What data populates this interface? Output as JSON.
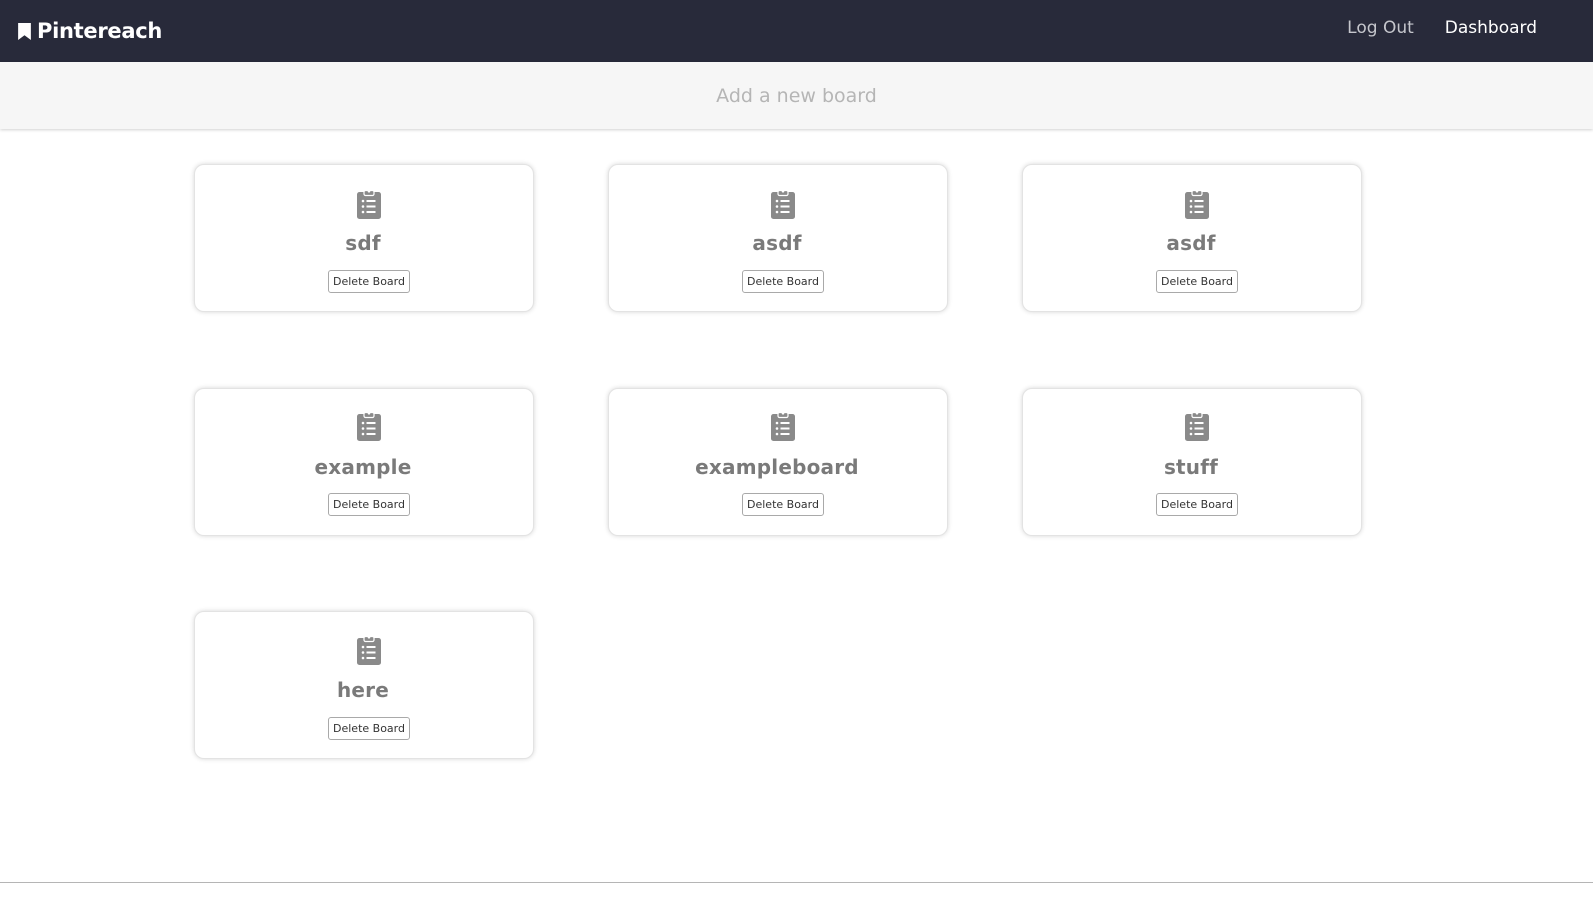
{
  "brand": {
    "name": "Pintereach",
    "icon": "bookmark-icon"
  },
  "nav": {
    "logout_label": "Log Out",
    "dashboard_label": "Dashboard"
  },
  "add_board": {
    "placeholder": "Add a new board"
  },
  "boards": [
    {
      "name": "sdf",
      "delete_label": "Delete Board",
      "icon": "clipboard-list-icon"
    },
    {
      "name": "asdf",
      "delete_label": "Delete Board",
      "icon": "clipboard-list-icon"
    },
    {
      "name": "asdf",
      "delete_label": "Delete Board",
      "icon": "clipboard-list-icon"
    },
    {
      "name": "example",
      "delete_label": "Delete Board",
      "icon": "clipboard-list-icon"
    },
    {
      "name": "exampleboard",
      "delete_label": "Delete Board",
      "icon": "clipboard-list-icon"
    },
    {
      "name": "stuff",
      "delete_label": "Delete Board",
      "icon": "clipboard-list-icon"
    },
    {
      "name": "here",
      "delete_label": "Delete Board",
      "icon": "clipboard-list-icon"
    }
  ],
  "colors": {
    "navbar": "#282a3a",
    "add_bar": "#f6f6f6",
    "icon_gray": "#8a8a8a",
    "board_name": "#7a7a7a"
  }
}
